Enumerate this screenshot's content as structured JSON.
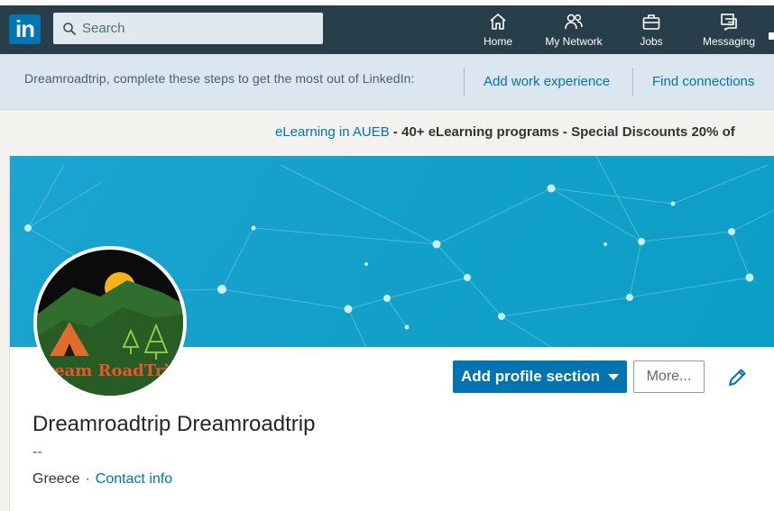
{
  "nav": {
    "logo_text": "in",
    "search_placeholder": "Search",
    "items": [
      {
        "label": "Home",
        "icon": "home-icon"
      },
      {
        "label": "My Network",
        "icon": "network-icon"
      },
      {
        "label": "Jobs",
        "icon": "briefcase-icon"
      },
      {
        "label": "Messaging",
        "icon": "messaging-icon"
      }
    ]
  },
  "steps": {
    "prompt": "Dreamroadtrip, complete these steps to get the most out of LinkedIn:",
    "links": [
      "Add work experience",
      "Find connections"
    ]
  },
  "ad": {
    "link": "eLearning in AUEB",
    "rest": " - 40+ eLearning programs - Special Discounts 20% of"
  },
  "profile": {
    "avatar_text": "Dream RoadTrip",
    "add_section_label": "Add profile section",
    "more_label": "More...",
    "name": "Dreamroadtrip Dreamroadtrip",
    "headline": "--",
    "location": "Greece",
    "separator": "·",
    "contact_label": "Contact info"
  },
  "colors": {
    "nav_bg": "#283e4a",
    "brand_blue": "#0073b1",
    "steps_bg": "#dce6f1",
    "cover": "#13a0c9"
  }
}
